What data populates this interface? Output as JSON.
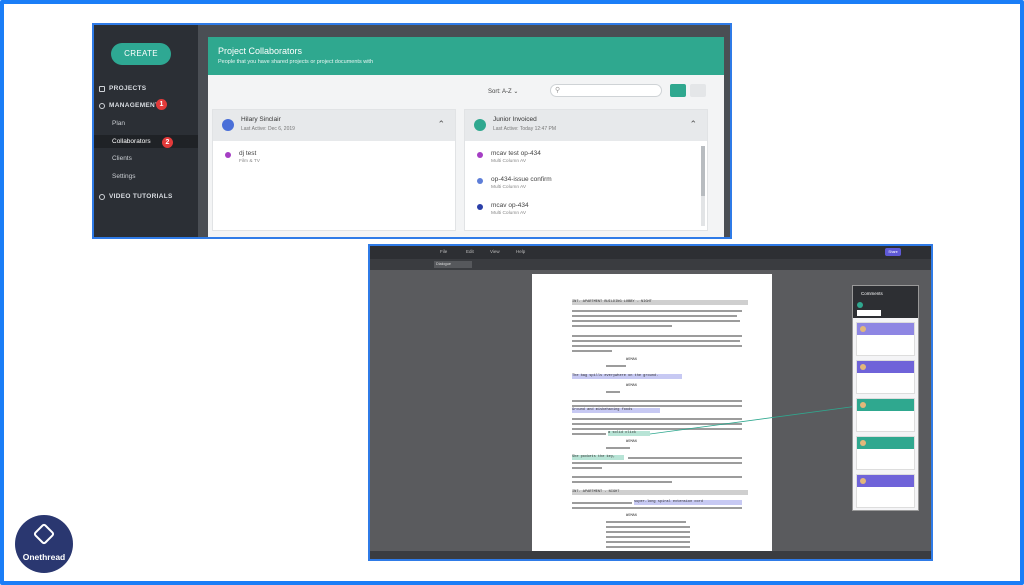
{
  "sidebar": {
    "create_label": "CREATE",
    "projects_label": "PROJECTS",
    "management_label": "MANAGEMENT",
    "sub_items": [
      "Plan",
      "Collaborators",
      "Clients",
      "Settings"
    ],
    "video_tutorials_label": "VIDEO TUTORIALS",
    "badges": [
      "1",
      "2"
    ]
  },
  "collab_page": {
    "title": "Project Collaborators",
    "subtitle": "People that you have shared projects or project documents with",
    "sort_label": "Sort:",
    "sort_value": "A-Z"
  },
  "cards": [
    {
      "name": "Hilary Sinclair",
      "last_active": "Last Active: Dec 6, 2019",
      "avatar_color": "#4a6fd8",
      "projects": [
        {
          "name": "dj test",
          "meta": "Film & TV",
          "color": "#a53ec4"
        }
      ]
    },
    {
      "name": "Junior Invoiced",
      "last_active": "Last Active: Today 12:47 PM",
      "avatar_color": "#2fa88f",
      "projects": [
        {
          "name": "mcav test op-434",
          "meta": "Multi Column AV",
          "color": "#a53ec4"
        },
        {
          "name": "op-434-issue confirm",
          "meta": "Multi Column AV",
          "color": "#5e7ed8"
        },
        {
          "name": "mcav op-434",
          "meta": "Multi Column AV",
          "color": "#2a3fa8"
        }
      ]
    }
  ],
  "editor": {
    "menu": [
      "File",
      "Edit",
      "View",
      "Help"
    ],
    "share_label": "Share",
    "format_select": "Dialogue",
    "comments_title": "Comments"
  },
  "script_lines": {
    "scene1": "INT. APARTMENT BUILDING LOBBY - NIGHT",
    "scene2": "INT. APARTMENT - NIGHT",
    "cue_woman": "WOMAN",
    "hl1": "The bag spills everywhere on the ground.",
    "hl2": "Ground and misbehaving foods",
    "hl3": "a solid click",
    "hl4": "She pockets the key,",
    "hl5": "super-long spiral extension cord"
  },
  "logo": {
    "text": "Onethread"
  },
  "colors": {
    "accent": "#2fa88f",
    "frame": "#1a7ef7",
    "badge": "#e33a3a",
    "comment_purple": "#6f63d9",
    "comment_green": "#2fa88f"
  }
}
